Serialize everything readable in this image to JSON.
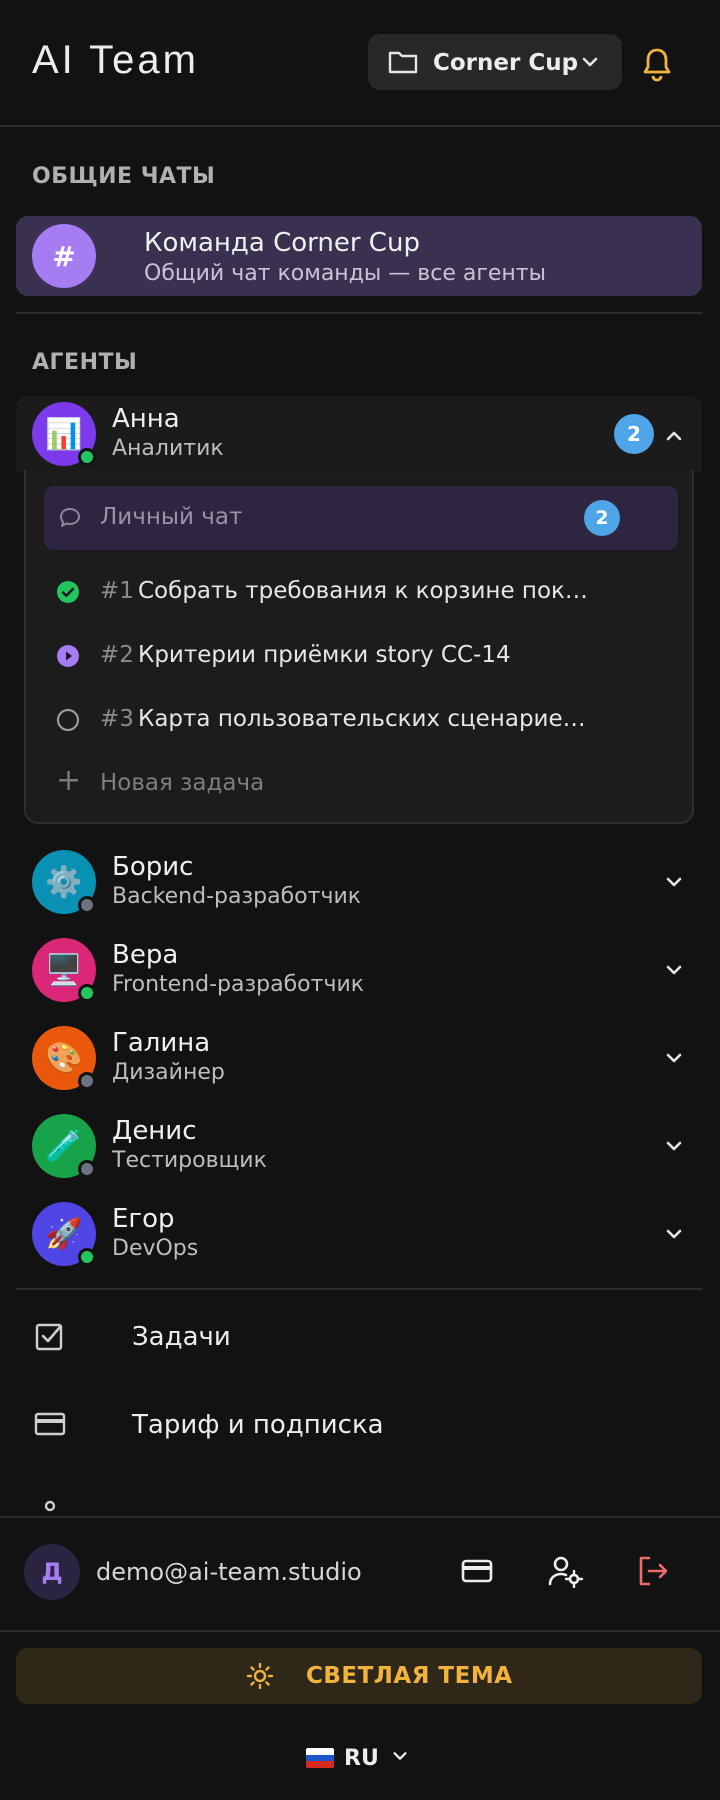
{
  "header": {
    "title": "AI Team",
    "project": "Corner Cup"
  },
  "sections": {
    "general_chats": "ОБЩИЕ ЧАТЫ",
    "agents": "АГЕНТЫ"
  },
  "team_chat": {
    "avatar": "#",
    "title": "Команда Corner Cup",
    "subtitle": "Общий чат команды — все агенты"
  },
  "agents": [
    {
      "name": "Анна",
      "role": "Аналитик",
      "icon": "📊",
      "status": "online",
      "expanded": true,
      "badge": "2",
      "color": "#7c3aed"
    },
    {
      "name": "Борис",
      "role": "Backend-разработчик",
      "icon": "⚙️",
      "status": "offline",
      "color": "#0891b2"
    },
    {
      "name": "Вера",
      "role": "Frontend-разработчик",
      "icon": "🖥️",
      "status": "online",
      "color": "#db2777"
    },
    {
      "name": "Галина",
      "role": "Дизайнер",
      "icon": "🎨",
      "status": "offline",
      "color": "#ea580c"
    },
    {
      "name": "Денис",
      "role": "Тестировщик",
      "icon": "🧪",
      "status": "offline",
      "color": "#16a34a"
    },
    {
      "name": "Егор",
      "role": "DevOps",
      "icon": "🚀",
      "status": "online",
      "color": "#4f46e5"
    }
  ],
  "agent_panel": {
    "private_chat": "Личный чат",
    "private_badge": "2",
    "tasks": [
      {
        "num": "#1",
        "title": "Собрать требования к корзине покупок",
        "state": "done"
      },
      {
        "num": "#2",
        "title": "Критерии приёмки story CC-14",
        "state": "in-progress"
      },
      {
        "num": "#3",
        "title": "Карта пользовательских сценариев по…",
        "state": "todo"
      }
    ],
    "new_task": "Новая задача"
  },
  "nav": {
    "tasks": "Задачи",
    "billing": "Тариф и подписка"
  },
  "user": {
    "initial": "Д",
    "email": "demo@ai-team.studio"
  },
  "theme_button": "СВЕТЛАЯ ТЕМА",
  "language": "RU",
  "colors": {
    "accent": "#a57cf2",
    "badge": "#4ea6e8",
    "online": "#22c55e",
    "offline": "#6b7280",
    "warning": "#f2b33d",
    "logout": "#ef6b6b"
  }
}
